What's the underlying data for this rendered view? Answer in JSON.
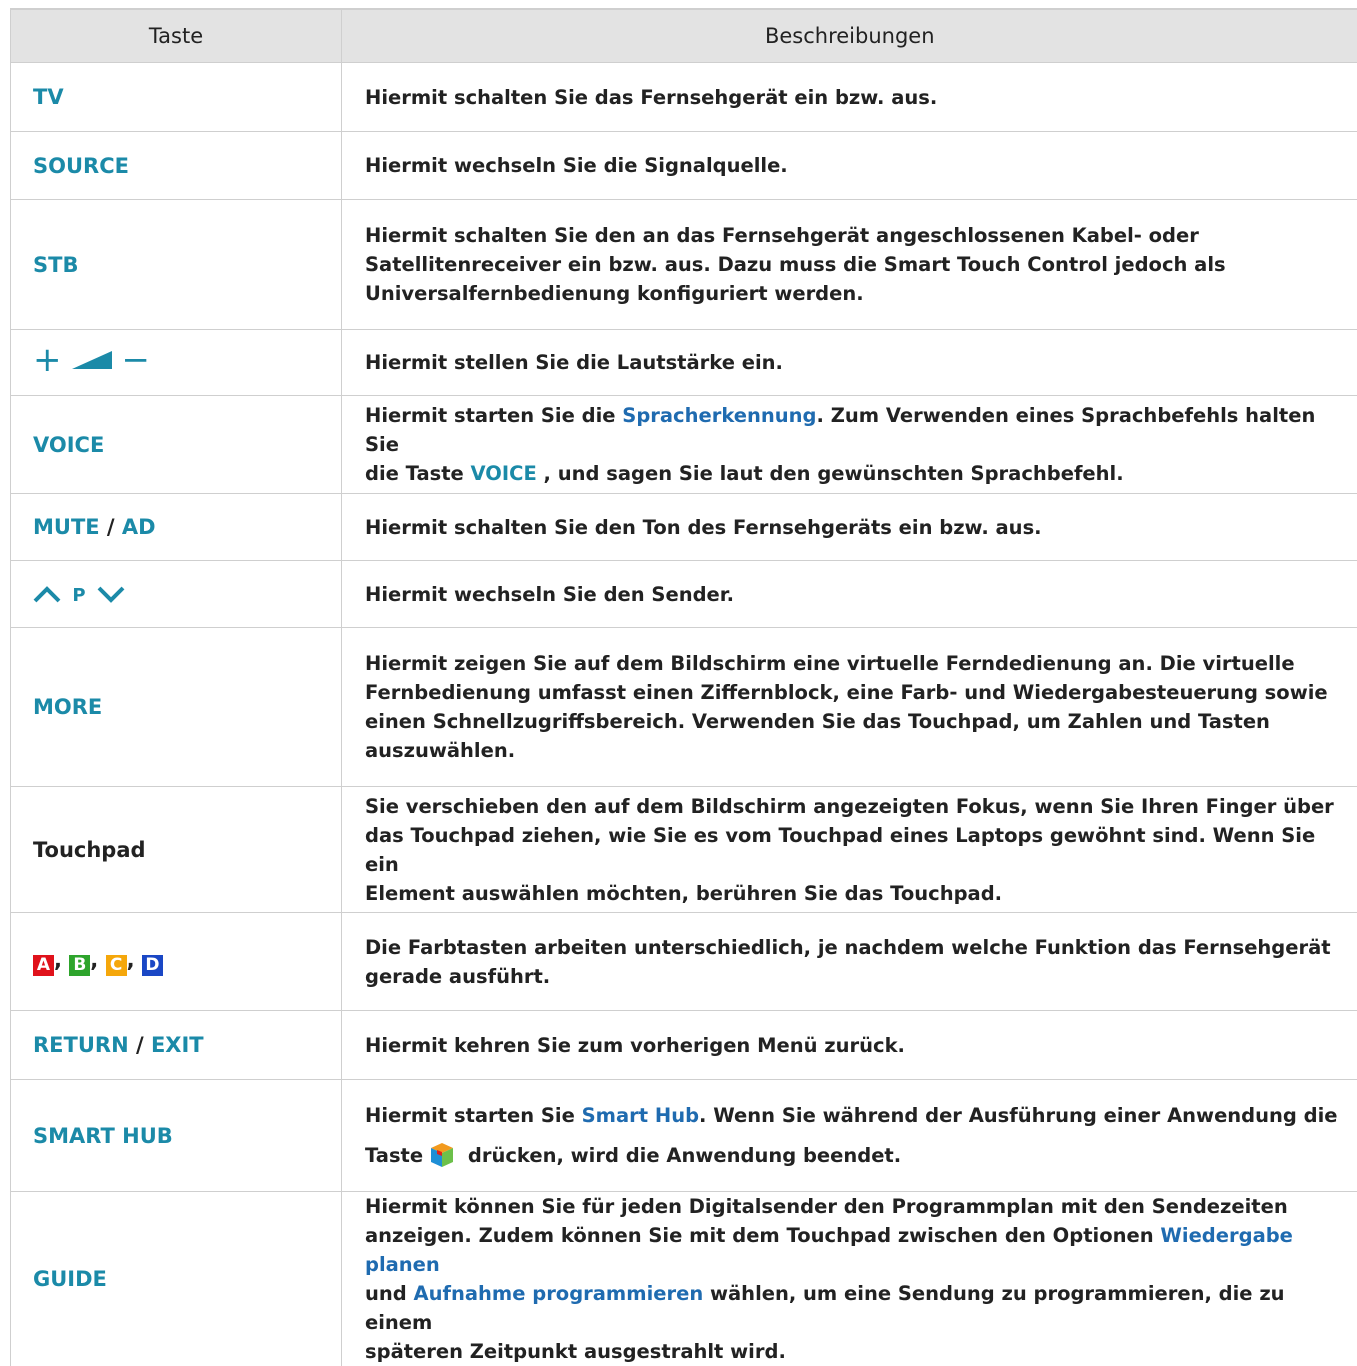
{
  "header": {
    "col1": "Taste",
    "col2": "Beschreibungen"
  },
  "rows": [
    {
      "key": "TV",
      "desc": "Hiermit schalten Sie das Fernsehgerät ein bzw. aus."
    },
    {
      "key": "SOURCE",
      "desc": "Hiermit wechseln Sie die Signalquelle."
    },
    {
      "key": "STB",
      "desc_line1": "Hiermit schalten Sie den an das Fernsehgerät angeschlossenen Kabel- oder",
      "desc_line2": "Satellitenreceiver ein bzw. aus. Dazu muss die Smart Touch Control jedoch als",
      "desc_line3": "Universalfernbedienung konfiguriert werden."
    },
    {
      "key_plus": "+",
      "key_minus": "−",
      "desc": "Hiermit stellen Sie die Lautstärke ein."
    },
    {
      "key": "VOICE",
      "desc_a": "Hiermit starten Sie die ",
      "desc_link": "Spracherkennung",
      "desc_b": ". Zum Verwenden eines Sprachbefehls halten Sie",
      "desc_c": "die Taste ",
      "desc_key": "VOICE",
      "desc_d": " , und sagen Sie laut den gewünschten Sprachbefehl."
    },
    {
      "key_a": "MUTE",
      "key_sep": " / ",
      "key_b": "AD",
      "desc": "Hiermit schalten Sie den Ton des Fernsehgeräts ein bzw. aus."
    },
    {
      "key_mid": "P",
      "desc": "Hiermit wechseln Sie den Sender."
    },
    {
      "key": "MORE",
      "desc_line1": "Hiermit zeigen Sie auf dem Bildschirm eine virtuelle Ferndedienung an. Die virtuelle",
      "desc_line2": "Fernbedienung umfasst einen Ziffernblock, eine Farb- und Wiedergabesteuerung sowie",
      "desc_line3": "einen Schnellzugriffsbereich. Verwenden Sie das Touchpad, um Zahlen und Tasten",
      "desc_line4": "auszuwählen."
    },
    {
      "key": "Touchpad",
      "desc_line1": "Sie verschieben den auf dem Bildschirm angezeigten Fokus, wenn Sie Ihren Finger über",
      "desc_line2": "das Touchpad ziehen, wie Sie es vom Touchpad eines Laptops gewöhnt sind. Wenn Sie ein",
      "desc_line3": "Element auswählen möchten, berühren Sie das Touchpad."
    },
    {
      "keys": [
        "A",
        "B",
        "C",
        "D"
      ],
      "key_colors": [
        "#e0121b",
        "#2ea42c",
        "#f5a70b",
        "#1a47c5"
      ],
      "comma": ",",
      "desc_line1": "Die Farbtasten arbeiten unterschiedlich, je nachdem welche Funktion das Fernsehgerät",
      "desc_line2": "gerade ausführt."
    },
    {
      "key_a": "RETURN",
      "key_sep": " / ",
      "key_b": "EXIT",
      "desc": "Hiermit kehren Sie zum vorherigen Menü zurück."
    },
    {
      "key": "SMART HUB",
      "desc_a": "Hiermit starten Sie ",
      "desc_link": "Smart Hub",
      "desc_b": ". Wenn Sie während der Ausführung einer Anwendung die",
      "desc_c": "Taste",
      "desc_d": " drücken, wird die Anwendung beendet."
    },
    {
      "key": "GUIDE",
      "desc_line1": "Hiermit können Sie für jeden Digitalsender den Programmplan mit den Sendezeiten",
      "desc_line2a": "anzeigen. Zudem können Sie mit dem Touchpad zwischen den Optionen ",
      "desc_link1": "Wiedergabe planen",
      "desc_line3a": "und ",
      "desc_link2": "Aufnahme programmieren",
      "desc_line3b": " wählen, um eine Sendung zu programmieren, die zu einem",
      "desc_line4": "späteren Zeitpunkt ausgestrahlt wird."
    }
  ],
  "colors": {
    "key": "#1b8aa8",
    "link": "#1f6bb0",
    "header_bg": "#e3e3e3"
  }
}
